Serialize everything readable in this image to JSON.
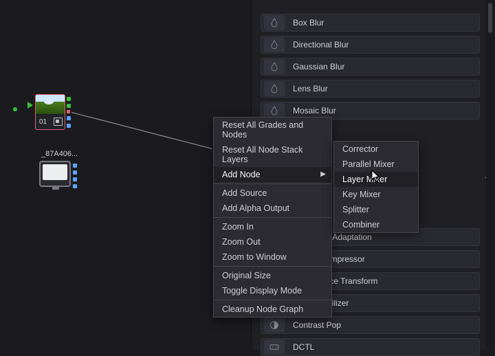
{
  "node1": {
    "number": "01"
  },
  "clip": {
    "label": "_87A406..."
  },
  "effects": {
    "list1": [
      "Box Blur",
      "Directional Blur",
      "Gaussian Blur",
      "Lens Blur",
      "Mosaic Blur"
    ],
    "list2": [
      "Chromatic Adaptation",
      "Gamut Compressor",
      "Color Space Transform",
      "Color Stabilizer",
      "Contrast Pop",
      "DCTL"
    ]
  },
  "context_menu": {
    "items": [
      "Reset All Grades and Nodes",
      "Reset All Node Stack Layers",
      "Add Node",
      "Add Source",
      "Add Alpha Output",
      "Zoom In",
      "Zoom Out",
      "Zoom to Window",
      "Original Size",
      "Toggle Display Mode",
      "Cleanup Node Graph"
    ],
    "submenu": [
      "Corrector",
      "Parallel Mixer",
      "Layer Mixer",
      "Key Mixer",
      "Splitter",
      "Combiner"
    ]
  }
}
